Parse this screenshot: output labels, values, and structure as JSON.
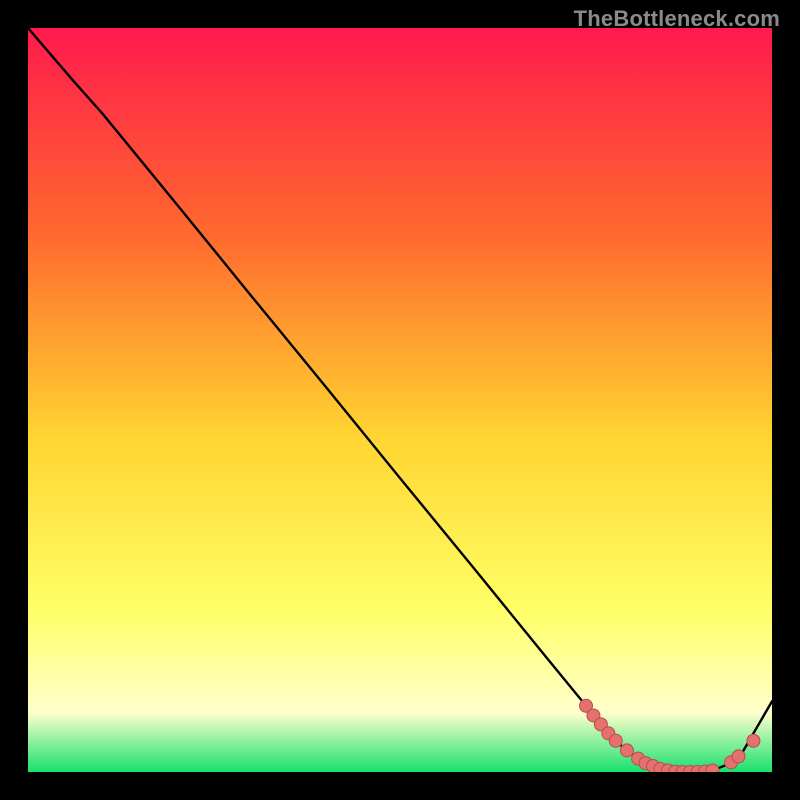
{
  "watermark": "TheBottleneck.com",
  "colors": {
    "bg_black": "#000000",
    "grad_top": "#ff1a4d",
    "grad_mid1": "#ff6a2e",
    "grad_mid2": "#ffd531",
    "grad_mid3": "#ffff66",
    "grad_pale": "#ffffcc",
    "grad_green": "#18e06e",
    "curve": "#000000",
    "dot_fill": "#e4716e",
    "dot_stroke": "#b64e4c"
  },
  "chart_data": {
    "type": "line",
    "title": "",
    "xlabel": "",
    "ylabel": "",
    "xlim": [
      0,
      100
    ],
    "ylim": [
      0,
      100
    ],
    "series": [
      {
        "name": "bottleneck-curve",
        "x": [
          0,
          6,
          10,
          20,
          30,
          40,
          50,
          60,
          70,
          75,
          78,
          80,
          82,
          84,
          86,
          88,
          90,
          92,
          94,
          96,
          100
        ],
        "y": [
          100,
          93,
          88.5,
          76.3,
          64,
          51.8,
          39.5,
          27.3,
          15,
          8.9,
          5.2,
          3.3,
          1.8,
          0.8,
          0.2,
          0,
          0,
          0.2,
          1,
          2.6,
          9.5
        ]
      }
    ],
    "markers": {
      "name": "highlight-dots",
      "points": [
        {
          "x": 75,
          "y": 8.9
        },
        {
          "x": 76,
          "y": 7.6
        },
        {
          "x": 77,
          "y": 6.4
        },
        {
          "x": 78,
          "y": 5.2
        },
        {
          "x": 79,
          "y": 4.2
        },
        {
          "x": 80.5,
          "y": 2.9
        },
        {
          "x": 82,
          "y": 1.8
        },
        {
          "x": 83,
          "y": 1.2
        },
        {
          "x": 84,
          "y": 0.8
        },
        {
          "x": 85,
          "y": 0.4
        },
        {
          "x": 86,
          "y": 0.2
        },
        {
          "x": 87,
          "y": 0.05
        },
        {
          "x": 88,
          "y": 0
        },
        {
          "x": 89,
          "y": 0
        },
        {
          "x": 90,
          "y": 0
        },
        {
          "x": 91,
          "y": 0.05
        },
        {
          "x": 92,
          "y": 0.2
        },
        {
          "x": 94.5,
          "y": 1.3
        },
        {
          "x": 95.5,
          "y": 2.1
        },
        {
          "x": 97.5,
          "y": 4.2
        }
      ]
    }
  }
}
